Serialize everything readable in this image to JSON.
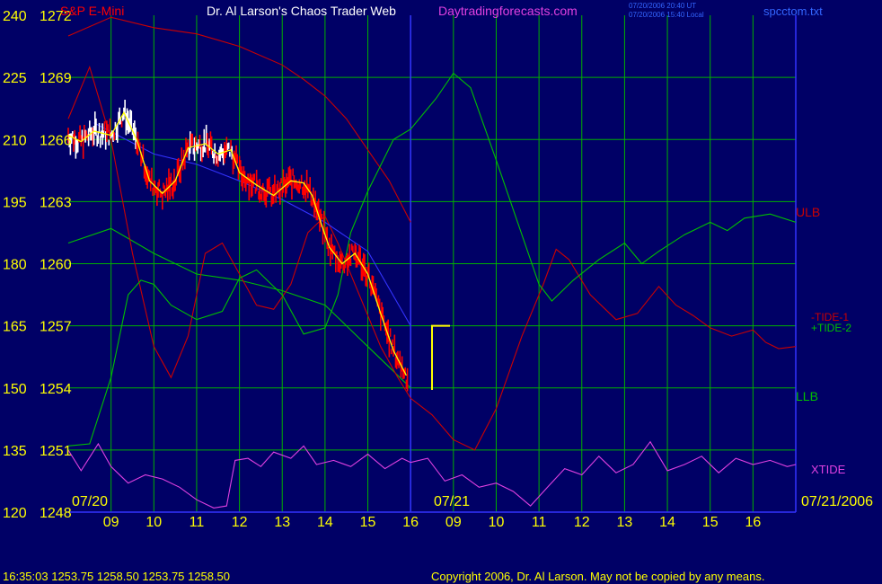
{
  "header": {
    "title": "Dr. Al Larson's Chaos Trader Web",
    "site": "Daytradingforecasts.com",
    "instrument": "S&P E-Mini",
    "time_ut": "07/20/2006 20:40 UT",
    "time_local": "07/20/2006 15:40 Local",
    "filename": "spcctom.txt"
  },
  "footer": {
    "ohlc": "16:35:03  1253.75 1258.50 1253.75 1258.50",
    "copyright": "Copyright 2006, Dr. Al Larson. May not be copied by any means."
  },
  "colors": {
    "background": "#000066",
    "grid": "#00b000",
    "price_up": "#ffffff",
    "price_down": "#ff0000",
    "average": "#ffff00",
    "trendline": "#3333ff",
    "upper_band": "#cc0000",
    "lower_band": "#00c000",
    "tide_minus_1": "#cc0000",
    "tide_plus_2": "#00c000",
    "xtide": "#e040e0",
    "axis_text": "#ffff00"
  },
  "chart_data": {
    "type": "line",
    "y_left_outer": [
      "240",
      "225",
      "210",
      "195",
      "180",
      "165",
      "150",
      "135",
      "120"
    ],
    "y_left_inner": [
      "1272",
      "1269",
      "1266",
      "1263",
      "1260",
      "1257",
      "1254",
      "1251",
      "1248"
    ],
    "ylim": [
      1248,
      1272
    ],
    "x_ticks": [
      "09",
      "10",
      "11",
      "12",
      "13",
      "14",
      "15",
      "16",
      "09",
      "10",
      "11",
      "12",
      "13",
      "14",
      "15",
      "16"
    ],
    "date_labels": [
      "07/20",
      "07/21",
      "07/21/2006"
    ],
    "now_marker_hour": 16,
    "series": [
      {
        "name": "ULB",
        "color": "#cc0000",
        "points": [
          [
            8.0,
            1271.0
          ],
          [
            9.0,
            1271.9
          ],
          [
            10.0,
            1271.4
          ],
          [
            11.0,
            1271.1
          ],
          [
            12.0,
            1270.5
          ],
          [
            13.0,
            1269.6
          ],
          [
            13.5,
            1268.9
          ],
          [
            14.0,
            1268.1
          ],
          [
            14.5,
            1267.0
          ],
          [
            15.0,
            1265.5
          ],
          [
            15.5,
            1264.0
          ],
          [
            16.0,
            1262.0
          ]
        ]
      },
      {
        "name": "LLB",
        "color": "#00c000",
        "points": [
          [
            8.0,
            1261.0
          ],
          [
            9.0,
            1261.7
          ],
          [
            10.0,
            1260.5
          ],
          [
            11.0,
            1259.5
          ],
          [
            12.0,
            1259.2
          ],
          [
            13.0,
            1258.7
          ],
          [
            14.0,
            1258.0
          ],
          [
            14.5,
            1257.0
          ],
          [
            15.0,
            1256.0
          ],
          [
            15.5,
            1255.0
          ],
          [
            16.0,
            1254.0
          ]
        ]
      },
      {
        "name": "-TIDE-1",
        "color": "#cc0000",
        "points": [
          [
            8.0,
            1267.0
          ],
          [
            8.5,
            1269.5
          ],
          [
            9.0,
            1266.0
          ],
          [
            9.5,
            1260.5
          ],
          [
            10.0,
            1256.0
          ],
          [
            10.4,
            1254.5
          ],
          [
            10.8,
            1256.5
          ],
          [
            11.2,
            1260.5
          ],
          [
            11.6,
            1261.0
          ],
          [
            12.0,
            1259.5
          ],
          [
            12.4,
            1258.0
          ],
          [
            12.8,
            1257.8
          ],
          [
            13.2,
            1259.0
          ],
          [
            13.6,
            1261.5
          ],
          [
            14.0,
            1262.3
          ],
          [
            14.3,
            1261.0
          ],
          [
            14.8,
            1258.5
          ],
          [
            15.3,
            1256.0
          ],
          [
            15.7,
            1254.5
          ],
          [
            16.0,
            1253.5
          ],
          [
            16.5,
            1252.7
          ],
          [
            17.0,
            1251.5
          ],
          [
            17.5,
            1251.0
          ],
          [
            18.0,
            1253.0
          ],
          [
            18.6,
            1256.5
          ],
          [
            19.1,
            1259.0
          ],
          [
            19.4,
            1260.7
          ],
          [
            19.7,
            1260.2
          ],
          [
            20.2,
            1258.5
          ],
          [
            20.8,
            1257.3
          ],
          [
            21.3,
            1257.6
          ],
          [
            21.8,
            1258.9
          ],
          [
            22.2,
            1258.0
          ],
          [
            22.6,
            1257.5
          ],
          [
            23.0,
            1256.9
          ],
          [
            23.5,
            1256.5
          ],
          [
            24.0,
            1256.8
          ],
          [
            24.3,
            1256.2
          ],
          [
            24.6,
            1255.9
          ],
          [
            25.0,
            1256.0
          ]
        ]
      },
      {
        "name": "+TIDE-2",
        "color": "#00c000",
        "points": [
          [
            8.0,
            1251.2
          ],
          [
            8.5,
            1251.3
          ],
          [
            9.0,
            1254.5
          ],
          [
            9.4,
            1258.5
          ],
          [
            9.7,
            1259.2
          ],
          [
            10.0,
            1259.0
          ],
          [
            10.4,
            1258.0
          ],
          [
            11.0,
            1257.3
          ],
          [
            11.6,
            1257.7
          ],
          [
            12.0,
            1259.3
          ],
          [
            12.4,
            1259.7
          ],
          [
            13.0,
            1258.5
          ],
          [
            13.5,
            1256.6
          ],
          [
            14.0,
            1256.9
          ],
          [
            14.3,
            1258.5
          ],
          [
            14.6,
            1261.5
          ],
          [
            15.0,
            1263.5
          ],
          [
            15.6,
            1266.0
          ],
          [
            16.0,
            1266.5
          ],
          [
            16.6,
            1268.0
          ],
          [
            17.0,
            1269.2
          ],
          [
            17.4,
            1268.5
          ],
          [
            18.0,
            1265.0
          ],
          [
            18.5,
            1262.0
          ],
          [
            19.0,
            1259.0
          ],
          [
            19.3,
            1258.2
          ],
          [
            19.8,
            1259.2
          ],
          [
            20.4,
            1260.2
          ],
          [
            21.0,
            1261.0
          ],
          [
            21.4,
            1260.0
          ],
          [
            21.8,
            1260.6
          ],
          [
            22.4,
            1261.4
          ],
          [
            23.0,
            1262.0
          ],
          [
            23.4,
            1261.6
          ],
          [
            23.8,
            1262.2
          ],
          [
            24.4,
            1262.4
          ],
          [
            25.0,
            1262.0
          ]
        ]
      },
      {
        "name": "XTIDE",
        "color": "#e040e0",
        "points": [
          [
            8.0,
            1251.0
          ],
          [
            8.3,
            1250.0
          ],
          [
            8.7,
            1251.3
          ],
          [
            9.0,
            1250.2
          ],
          [
            9.4,
            1249.4
          ],
          [
            9.8,
            1249.8
          ],
          [
            10.2,
            1249.6
          ],
          [
            10.6,
            1249.2
          ],
          [
            11.0,
            1248.6
          ],
          [
            11.4,
            1248.2
          ],
          [
            11.7,
            1248.3
          ],
          [
            11.9,
            1250.5
          ],
          [
            12.2,
            1250.6
          ],
          [
            12.5,
            1250.2
          ],
          [
            12.8,
            1250.9
          ],
          [
            13.2,
            1250.6
          ],
          [
            13.5,
            1251.2
          ],
          [
            13.8,
            1250.3
          ],
          [
            14.2,
            1250.5
          ],
          [
            14.6,
            1250.2
          ],
          [
            15.0,
            1250.8
          ],
          [
            15.4,
            1250.1
          ],
          [
            15.8,
            1250.6
          ],
          [
            16.0,
            1250.4
          ],
          [
            16.4,
            1250.6
          ],
          [
            16.8,
            1249.5
          ],
          [
            17.2,
            1249.8
          ],
          [
            17.6,
            1249.2
          ],
          [
            18.0,
            1249.4
          ],
          [
            18.4,
            1249.0
          ],
          [
            18.8,
            1248.3
          ],
          [
            19.2,
            1249.2
          ],
          [
            19.6,
            1250.1
          ],
          [
            20.0,
            1249.8
          ],
          [
            20.4,
            1250.7
          ],
          [
            20.8,
            1249.9
          ],
          [
            21.2,
            1250.3
          ],
          [
            21.6,
            1251.4
          ],
          [
            22.0,
            1250.0
          ],
          [
            22.4,
            1250.3
          ],
          [
            22.8,
            1250.7
          ],
          [
            23.2,
            1249.9
          ],
          [
            23.6,
            1250.6
          ],
          [
            24.0,
            1250.3
          ],
          [
            24.4,
            1250.5
          ],
          [
            24.8,
            1250.2
          ],
          [
            25.0,
            1250.3
          ]
        ]
      },
      {
        "name": "Trendline",
        "color": "#3333ff",
        "points": [
          [
            8.6,
            1266.8
          ],
          [
            10.0,
            1265.3
          ],
          [
            11.0,
            1264.8
          ],
          [
            12.0,
            1264.0
          ],
          [
            13.0,
            1263.1
          ],
          [
            14.0,
            1262.0
          ],
          [
            15.0,
            1260.6
          ],
          [
            16.0,
            1257.0
          ]
        ]
      },
      {
        "name": "Average",
        "color": "#ffff00",
        "points": [
          [
            8.0,
            1266.2
          ],
          [
            8.3,
            1265.9
          ],
          [
            8.6,
            1266.4
          ],
          [
            9.0,
            1266.2
          ],
          [
            9.3,
            1267.3
          ],
          [
            9.6,
            1266.0
          ],
          [
            9.9,
            1264.0
          ],
          [
            10.2,
            1263.4
          ],
          [
            10.5,
            1264.0
          ],
          [
            10.8,
            1265.6
          ],
          [
            11.2,
            1265.8
          ],
          [
            11.5,
            1265.3
          ],
          [
            11.8,
            1265.5
          ],
          [
            12.0,
            1264.4
          ],
          [
            12.4,
            1263.8
          ],
          [
            12.8,
            1263.3
          ],
          [
            13.2,
            1264.0
          ],
          [
            13.5,
            1263.9
          ],
          [
            13.7,
            1263.3
          ],
          [
            13.9,
            1262.0
          ],
          [
            14.1,
            1260.8
          ],
          [
            14.4,
            1260.0
          ],
          [
            14.7,
            1260.5
          ],
          [
            15.0,
            1259.5
          ],
          [
            15.3,
            1257.6
          ],
          [
            15.6,
            1255.8
          ],
          [
            15.9,
            1254.6
          ]
        ]
      }
    ],
    "forecast_marker": {
      "x": 16.5,
      "y_top": 1257.0,
      "y_bottom": 1253.9
    },
    "legend_labels": [
      "ULB",
      "-TIDE-1",
      "+TIDE-2",
      "LLB",
      "XTIDE"
    ]
  }
}
